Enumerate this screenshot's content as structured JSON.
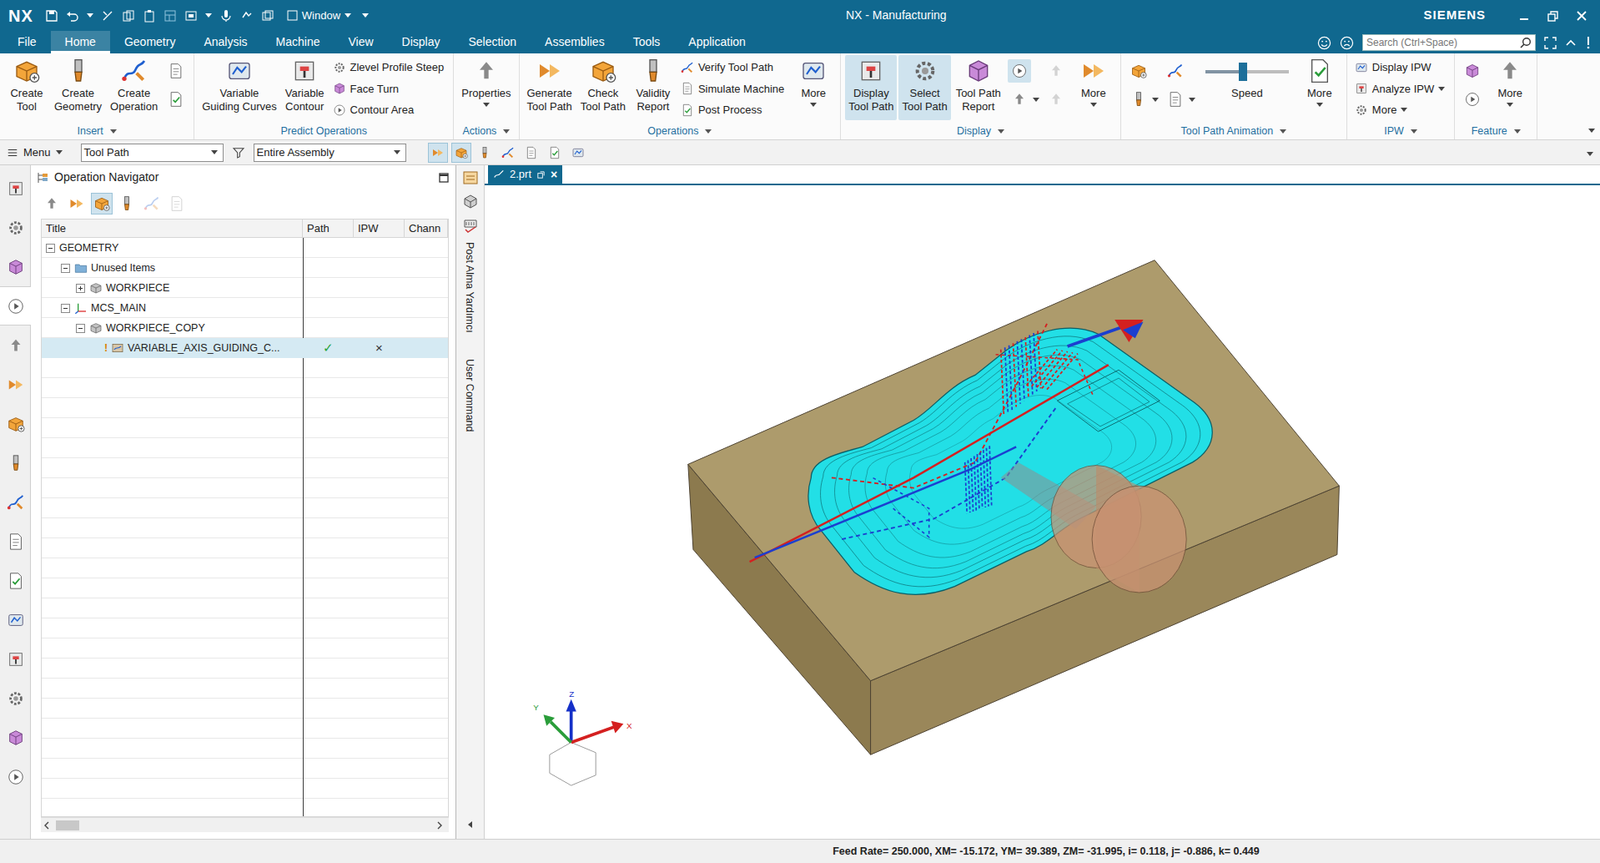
{
  "window": {
    "logo": "NX",
    "title": "NX - Manufacturing",
    "brand": "SIEMENS",
    "window_menu": "Window"
  },
  "menu_tabs": [
    {
      "label": "File",
      "selected": false
    },
    {
      "label": "Home",
      "selected": true
    },
    {
      "label": "Geometry",
      "selected": false
    },
    {
      "label": "Analysis",
      "selected": false
    },
    {
      "label": "Machine",
      "selected": false
    },
    {
      "label": "View",
      "selected": false
    },
    {
      "label": "Display",
      "selected": false
    },
    {
      "label": "Selection",
      "selected": false
    },
    {
      "label": "Assemblies",
      "selected": false
    },
    {
      "label": "Tools",
      "selected": false
    },
    {
      "label": "Application",
      "selected": false
    }
  ],
  "search": {
    "placeholder": "Search (Ctrl+Space)"
  },
  "ribbon": {
    "groups": [
      {
        "label": "Insert",
        "dropdown": true,
        "items": [
          {
            "kind": "large",
            "lines": [
              "Create",
              "Tool"
            ],
            "selected": false,
            "dropdown": false
          },
          {
            "kind": "large",
            "lines": [
              "Create",
              "Geometry"
            ],
            "selected": false,
            "dropdown": false
          },
          {
            "kind": "large",
            "lines": [
              "Create",
              "Operation"
            ],
            "selected": false,
            "dropdown": false
          },
          {
            "kind": "icons",
            "buttons": [
              {
                "selected": false,
                "disabled": false,
                "dropdown": false
              },
              {
                "selected": false,
                "disabled": false,
                "dropdown": false
              }
            ]
          }
        ]
      },
      {
        "label": "Predict Operations",
        "dropdown": false,
        "items": [
          {
            "kind": "large",
            "lines": [
              "Variable",
              "Guiding Curves"
            ],
            "selected": false,
            "dropdown": false
          },
          {
            "kind": "large",
            "lines": [
              "Variable",
              "Contour"
            ],
            "selected": false,
            "dropdown": false
          },
          {
            "kind": "stack",
            "buttons": [
              {
                "label": "Zlevel Profile Steep",
                "dropdown": false
              },
              {
                "label": "Face Turn",
                "dropdown": false
              },
              {
                "label": "Contour Area",
                "dropdown": false
              }
            ]
          }
        ]
      },
      {
        "label": "Actions",
        "dropdown": true,
        "items": [
          {
            "kind": "large",
            "lines": [
              "Properties"
            ],
            "selected": false,
            "dropdown": true
          }
        ]
      },
      {
        "label": "Operations",
        "dropdown": true,
        "items": [
          {
            "kind": "large",
            "lines": [
              "Generate",
              "Tool Path"
            ],
            "selected": false,
            "dropdown": false
          },
          {
            "kind": "large",
            "lines": [
              "Check",
              "Tool Path"
            ],
            "selected": false,
            "dropdown": false
          },
          {
            "kind": "large",
            "lines": [
              "Validity",
              "Report"
            ],
            "selected": false,
            "dropdown": false
          },
          {
            "kind": "stack",
            "buttons": [
              {
                "label": "Verify Tool Path",
                "dropdown": false
              },
              {
                "label": "Simulate Machine",
                "dropdown": false
              },
              {
                "label": "Post Process",
                "dropdown": false
              }
            ]
          },
          {
            "kind": "large",
            "lines": [
              "More"
            ],
            "selected": false,
            "dropdown": true
          }
        ]
      },
      {
        "label": "Display",
        "dropdown": true,
        "items": [
          {
            "kind": "large",
            "lines": [
              "Display",
              "Tool Path"
            ],
            "selected": true,
            "dropdown": false
          },
          {
            "kind": "large",
            "lines": [
              "Select",
              "Tool Path"
            ],
            "selected": true,
            "dropdown": false
          },
          {
            "kind": "large",
            "lines": [
              "Tool Path",
              "Report"
            ],
            "selected": false,
            "dropdown": false
          },
          {
            "kind": "icons",
            "buttons": [
              {
                "selected": true,
                "disabled": false,
                "dropdown": false
              },
              {
                "selected": false,
                "disabled": false,
                "dropdown": true
              }
            ]
          },
          {
            "kind": "icons",
            "buttons": [
              {
                "selected": false,
                "disabled": true,
                "dropdown": false
              },
              {
                "selected": false,
                "disabled": true,
                "dropdown": false
              }
            ]
          },
          {
            "kind": "large",
            "lines": [
              "More"
            ],
            "selected": false,
            "dropdown": true
          }
        ]
      },
      {
        "label": "Tool Path Animation",
        "dropdown": true,
        "items": [
          {
            "kind": "icons",
            "buttons": [
              {
                "selected": false,
                "disabled": false,
                "dropdown": false
              },
              {
                "selected": false,
                "disabled": false,
                "dropdown": true
              }
            ]
          },
          {
            "kind": "icons",
            "buttons": [
              {
                "selected": false,
                "disabled": false,
                "dropdown": false
              },
              {
                "selected": false,
                "disabled": false,
                "dropdown": true
              }
            ]
          },
          {
            "kind": "slider",
            "label": "Speed",
            "level": 0.45
          },
          {
            "kind": "large",
            "lines": [
              "More"
            ],
            "selected": false,
            "dropdown": true
          }
        ]
      },
      {
        "label": "IPW",
        "dropdown": true,
        "items": [
          {
            "kind": "stack",
            "buttons": [
              {
                "label": "Display IPW",
                "dropdown": false
              },
              {
                "label": "Analyze IPW",
                "dropdown": true
              },
              {
                "label": "More",
                "dropdown": true
              }
            ]
          }
        ]
      },
      {
        "label": "Feature",
        "dropdown": true,
        "items": [
          {
            "kind": "icons",
            "buttons": [
              {
                "selected": false,
                "disabled": false,
                "dropdown": false
              },
              {
                "selected": false,
                "disabled": false,
                "dropdown": false
              }
            ]
          },
          {
            "kind": "large",
            "lines": [
              "More"
            ],
            "selected": false,
            "dropdown": true
          }
        ]
      }
    ]
  },
  "selection_bar": {
    "menu": "Menu",
    "type_filter": "Tool Path",
    "scope": "Entire Assembly",
    "tools": [
      {
        "selected": true
      },
      {
        "selected": true
      },
      {
        "selected": false
      },
      {
        "selected": false
      },
      {
        "selected": false
      },
      {
        "selected": false
      },
      {
        "selected": false
      }
    ]
  },
  "resource_bar": [
    {
      "selected": false
    },
    {
      "selected": false
    },
    {
      "selected": false
    },
    {
      "selected": true
    },
    {
      "selected": false
    },
    {
      "selected": false
    },
    {
      "selected": false
    },
    {
      "selected": false
    },
    {
      "selected": false
    },
    {
      "selected": false
    },
    {
      "selected": false
    },
    {
      "selected": false
    },
    {
      "selected": false
    },
    {
      "selected": false
    },
    {
      "selected": false
    },
    {
      "selected": false
    }
  ],
  "navigator": {
    "title": "Operation Navigator",
    "toolbar": [
      {
        "selected": false,
        "disabled": false
      },
      {
        "selected": false,
        "disabled": false
      },
      {
        "selected": true,
        "disabled": false
      },
      {
        "selected": false,
        "disabled": false
      },
      {
        "selected": false,
        "disabled": true
      },
      {
        "selected": false,
        "disabled": true
      }
    ],
    "columns": [
      "Title",
      "Path",
      "IPW",
      "Chann"
    ],
    "rows": [
      {
        "title": "GEOMETRY",
        "level": 0,
        "kind": "root",
        "expandable": true,
        "expanded": true,
        "selected": false
      },
      {
        "title": "Unused Items",
        "level": 1,
        "kind": "folder",
        "expandable": true,
        "expanded": true,
        "selected": false
      },
      {
        "title": "WORKPIECE",
        "level": 2,
        "kind": "workpiece",
        "expandable": true,
        "expanded": false,
        "selected": false
      },
      {
        "title": "MCS_MAIN",
        "level": 1,
        "kind": "mcs",
        "expandable": true,
        "expanded": true,
        "selected": false
      },
      {
        "title": "WORKPIECE_COPY",
        "level": 2,
        "kind": "workpiece",
        "expandable": true,
        "expanded": true,
        "selected": false
      },
      {
        "title": "VARIABLE_AXIS_GUIDING_C...",
        "level": 3,
        "kind": "operation",
        "expandable": false,
        "selected": true,
        "flag": "!",
        "path": "✓",
        "ipw": "×"
      }
    ]
  },
  "side_strip": {
    "labels": [
      "Post Alma Yardımcı",
      "User Command"
    ]
  },
  "graphics": {
    "tab": {
      "label": "2.prt",
      "close": "×",
      "selected": true
    },
    "triad": {
      "x": "X",
      "y": "Y",
      "z": "Z"
    }
  },
  "status_bar": "Feed Rate= 250.000, XM= -15.172, YM= 39.389, ZM= -31.995, i= 0.118, j= -0.886, k= 0.449"
}
